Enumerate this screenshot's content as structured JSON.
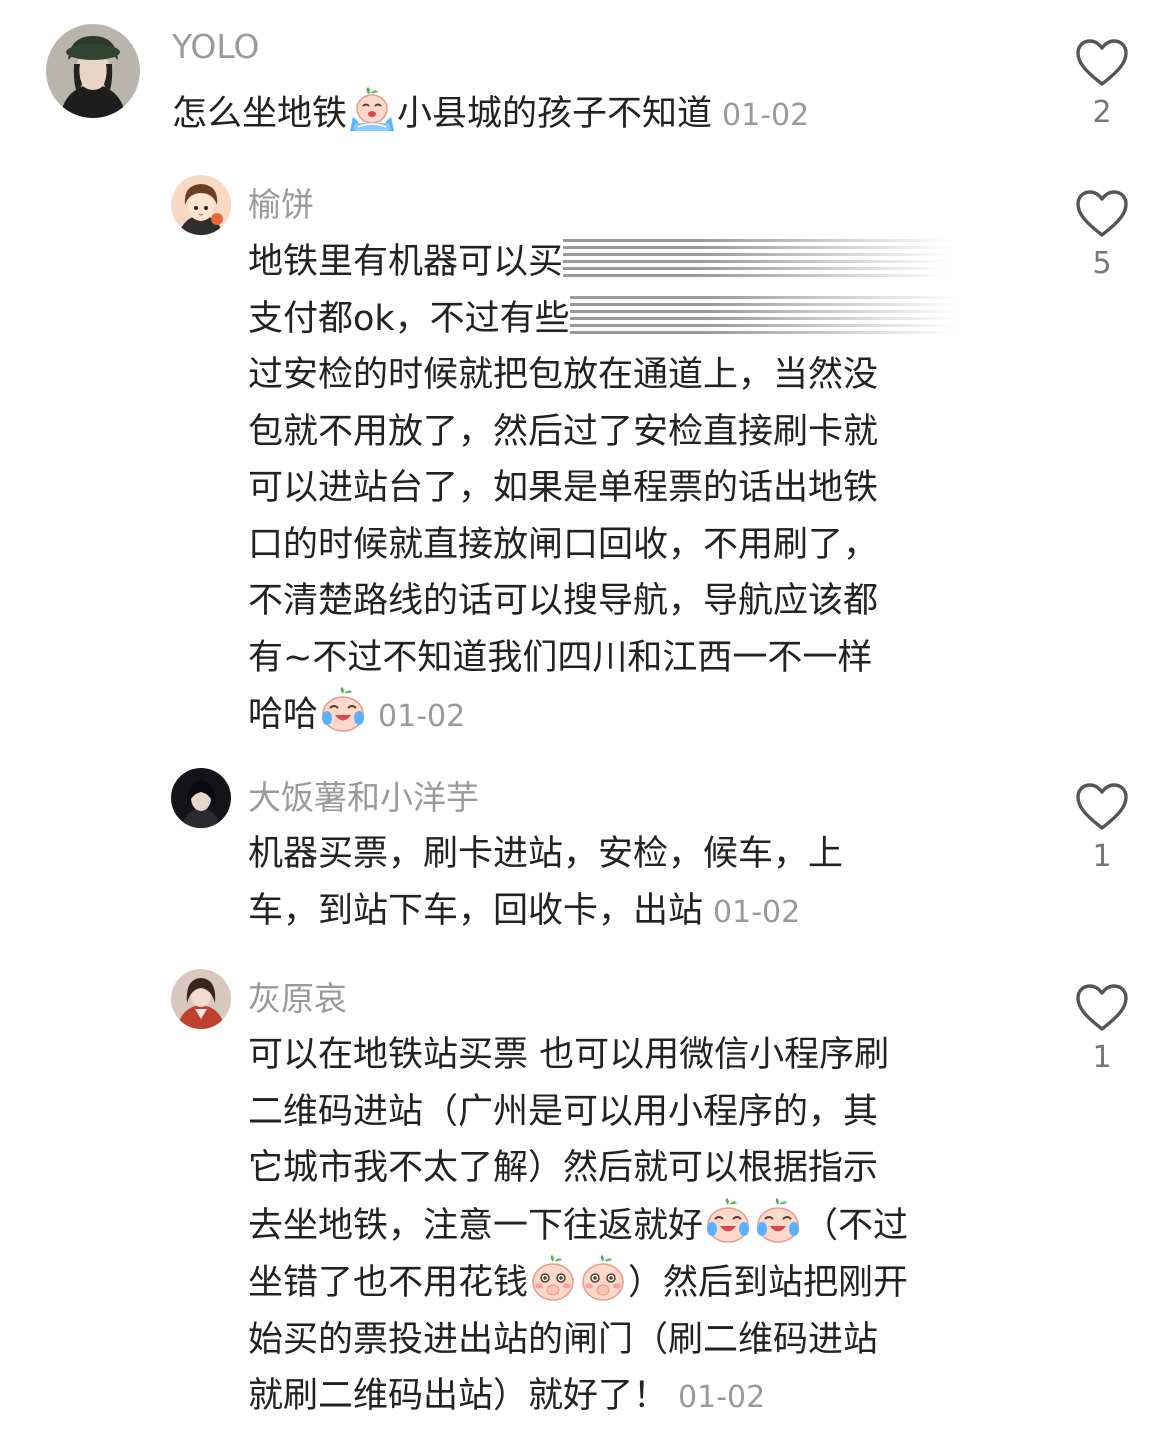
{
  "comments": [
    {
      "username": "YOLO",
      "text_parts": [
        "怎么坐地铁",
        "小县城的孩子不知道"
      ],
      "date": "01-02",
      "likes": "2"
    },
    {
      "username": "榆饼",
      "lines": {
        "l1": "地铁里有机器可以买",
        "l2": "支付都ok，不过有些",
        "l3": "过安检的时候就把包放在通道上，当然没",
        "l4": "包就不用放了，然后过了安检直接刷卡就",
        "l5": "可以进站台了，如果是单程票的话出地铁",
        "l6": "口的时候就直接放闸口回收，不用刷了，",
        "l7": "不清楚路线的话可以搜导航，导航应该都",
        "l8": "有~不过不知道我们四川和江西一不一样",
        "l9": "哈哈"
      },
      "date": "01-02",
      "likes": "5"
    },
    {
      "username": "大饭薯和小洋芋",
      "lines": {
        "l1": "机器买票，刷卡进站，安检，候车，上",
        "l2": "车，到站下车，回收卡，出站"
      },
      "date": "01-02",
      "likes": "1"
    },
    {
      "username": "灰原哀",
      "lines": {
        "l1": "可以在地铁站买票 也可以用微信小程序刷",
        "l2": "二维码进站（广州是可以用小程序的，其",
        "l3": "它城市我不太了解）然后就可以根据指示",
        "l4": "去坐地铁，注意一下往返就好",
        "l4b": "（不过",
        "l5": "坐错了也不用花钱",
        "l5b": "）然后到站把刚开",
        "l6": "始买的票投进出站的闸门（刷二维码进站",
        "l7": "就刷二维码出站）就好了！"
      },
      "date": "01-02",
      "likes": "1"
    }
  ],
  "icons": {
    "like": "heart-outline-icon",
    "emoji_1": "crying-face-emoji",
    "emoji_2": "laugh-cry-emoji",
    "emoji_3": "shy-emoji"
  },
  "colors": {
    "username": "#9a9a9a",
    "text": "#222222",
    "date": "#9a9a9a",
    "like_icon": "#555555"
  }
}
